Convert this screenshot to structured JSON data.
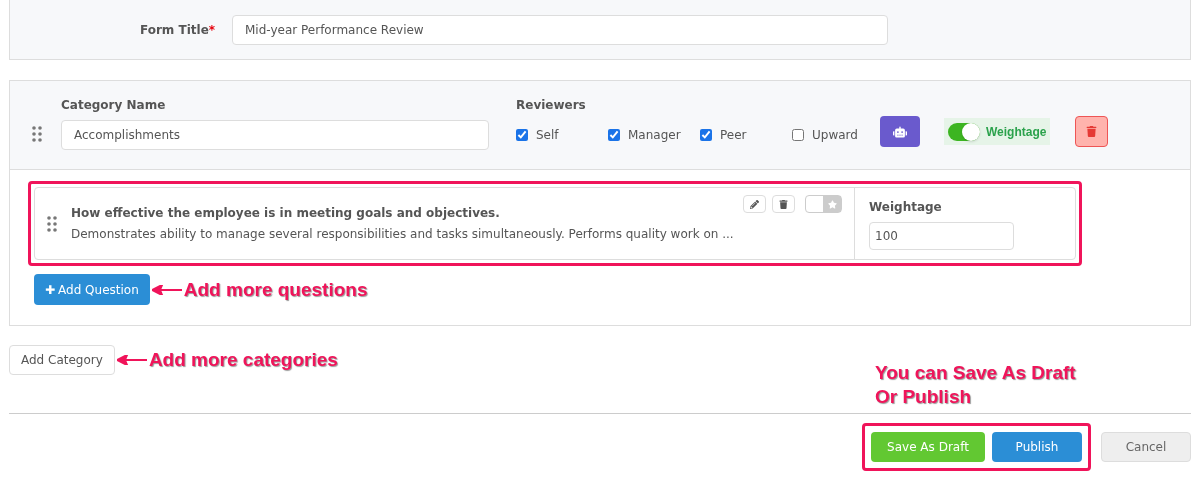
{
  "form_title": {
    "label": "Form Title",
    "required_mark": "*",
    "value": "Mid-year Performance Review"
  },
  "category": {
    "name_label": "Category Name",
    "name_value": "Accomplishments",
    "reviewers_label": "Reviewers",
    "reviewers": [
      {
        "label": "Self",
        "checked": true
      },
      {
        "label": "Manager",
        "checked": true
      },
      {
        "label": "Peer",
        "checked": true
      },
      {
        "label": "Upward",
        "checked": false
      }
    ],
    "weightage_toggle": {
      "label": "Weightage",
      "on": true
    }
  },
  "questions": [
    {
      "title": "How effective the employee is in meeting goals and objectives.",
      "description": "Demonstrates ability to manage several responsibilities and tasks simultaneously. Performs quality work on ...",
      "starred": false,
      "weightage_label": "Weightage",
      "weightage_value": "100"
    }
  ],
  "add_question": {
    "icon": "✚",
    "label": "Add Question",
    "annotation": "Add more questions"
  },
  "add_category": {
    "label": "Add Category",
    "annotation": "Add more categories"
  },
  "footer": {
    "annotation": "You can Save As Draft Or Publish",
    "save_draft": "Save As Draft",
    "publish": "Publish",
    "cancel": "Cancel"
  }
}
